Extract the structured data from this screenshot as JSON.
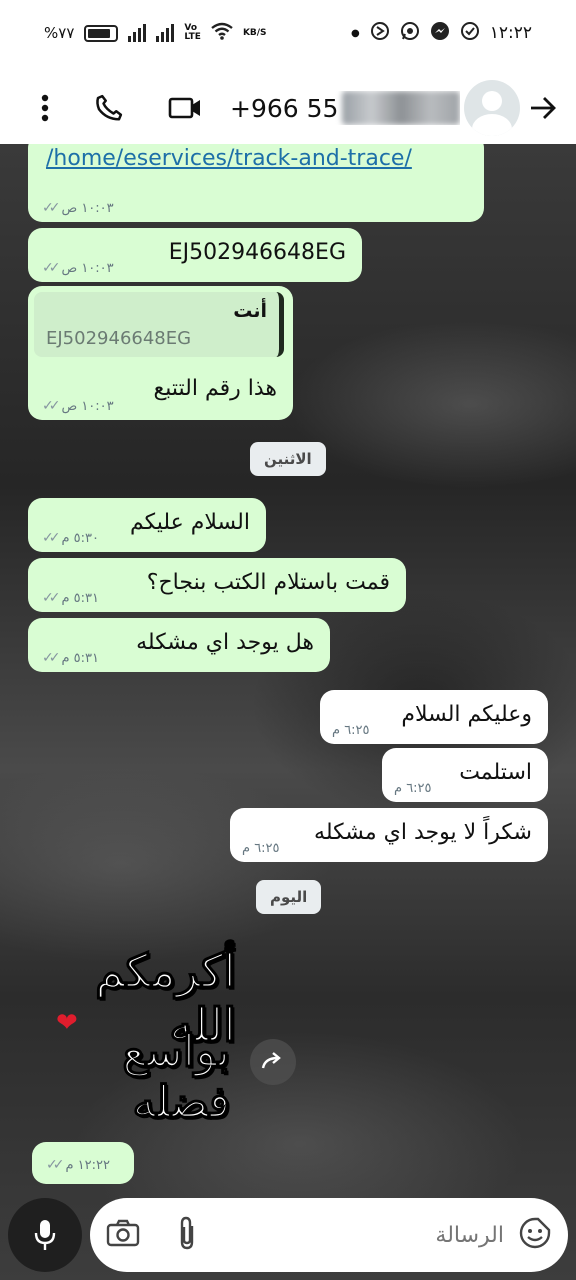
{
  "status_bar": {
    "battery": "%٧٧",
    "network_type": "LTE2",
    "volte_label": "Vo)) LTE2",
    "speed_unit": "KB/S",
    "time": "١٢:٢٢"
  },
  "header": {
    "contact_name": "+966 55",
    "icons": [
      "more-vert-icon",
      "phone-icon",
      "video-call-icon",
      "avatar",
      "back-arrow-icon"
    ]
  },
  "messages": [
    {
      "id": "m1",
      "direction": "outgoing",
      "text": "/home/eservices/track-and-trace/",
      "is_link": true,
      "time": "١٠:٠٣ ص",
      "status": "read"
    },
    {
      "id": "m2",
      "direction": "outgoing",
      "text": "EJ502946648EG",
      "time": "١٠:٠٣ ص",
      "status": "read"
    },
    {
      "id": "m3",
      "direction": "outgoing",
      "quote_author": "أنت",
      "quote_text": "EJ502946648EG",
      "text": "هذا رقم التتبع",
      "time": "١٠:٠٣ ص",
      "status": "read"
    },
    {
      "id": "m4",
      "direction": "outgoing",
      "text": "السلام عليكم",
      "time": "٥:٣٠ م",
      "status": "read"
    },
    {
      "id": "m5",
      "direction": "outgoing",
      "text": "قمت باستلام الكتب بنجاح؟",
      "time": "٥:٣١ م",
      "status": "read"
    },
    {
      "id": "m6",
      "direction": "outgoing",
      "text": "هل يوجد اي مشكله",
      "time": "٥:٣١ م",
      "status": "read"
    },
    {
      "id": "m7",
      "direction": "incoming",
      "text": "وعليكم السلام",
      "time": "٦:٢٥ م"
    },
    {
      "id": "m8",
      "direction": "incoming",
      "text": "استلمت",
      "time": "٦:٢٥ م"
    },
    {
      "id": "m9",
      "direction": "incoming",
      "text": "شكراً لا يوجد اي مشكله",
      "time": "٦:٢٥ م"
    },
    {
      "id": "m10",
      "direction": "outgoing",
      "type": "sticker",
      "sticker_line1": "أكرمكم الله",
      "sticker_line2": "بواسع فضله",
      "time": "١٢:٢٢ م",
      "status": "read"
    }
  ],
  "date_dividers": {
    "monday": "الاثنين",
    "today": "اليوم"
  },
  "input": {
    "placeholder": "الرسالة",
    "icons": [
      "emoji-icon",
      "attach-icon",
      "camera-icon",
      "mic-icon"
    ]
  }
}
